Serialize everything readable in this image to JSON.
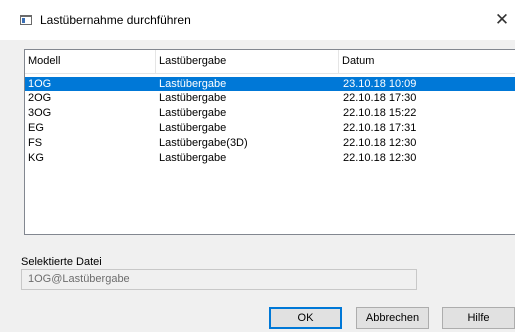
{
  "window": {
    "title": "Lastübernahme durchführen",
    "close_glyph": "✕",
    "app_icon": "window-app-icon"
  },
  "table": {
    "columns": [
      "Modell",
      "Lastübergabe",
      "Datum"
    ],
    "rows": [
      {
        "modell": "1OG",
        "lastuebergabe": "Lastübergabe",
        "datum": "23.10.18 10:09",
        "selected": true
      },
      {
        "modell": "2OG",
        "lastuebergabe": "Lastübergabe",
        "datum": "22.10.18 17:30",
        "selected": false
      },
      {
        "modell": "3OG",
        "lastuebergabe": "Lastübergabe",
        "datum": "22.10.18 15:22",
        "selected": false
      },
      {
        "modell": "EG",
        "lastuebergabe": "Lastübergabe",
        "datum": "22.10.18 17:31",
        "selected": false
      },
      {
        "modell": "FS",
        "lastuebergabe": "Lastübergabe(3D)",
        "datum": "22.10.18 12:30",
        "selected": false
      },
      {
        "modell": "KG",
        "lastuebergabe": "Lastübergabe",
        "datum": "22.10.18 12:30",
        "selected": false
      }
    ]
  },
  "selected_file": {
    "label": "Selektierte Datei",
    "value": "1OG@Lastübergabe"
  },
  "buttons": {
    "ok": "OK",
    "cancel": "Abbrechen",
    "help": "Hilfe"
  },
  "colors": {
    "selection": "#0078d7",
    "dialog_bg": "#f0f0f0"
  }
}
